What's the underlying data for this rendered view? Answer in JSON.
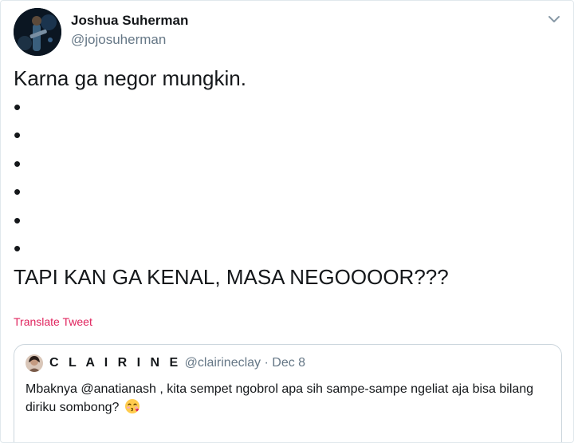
{
  "author": {
    "name": "Joshua Suherman",
    "handle": "@jojosuherman"
  },
  "tweet": {
    "text": "Karna ga negor mungkin.\n•\n•\n•\n•\n•\n•\nTAPI KAN GA KENAL, MASA NEGOOOOR???",
    "translate_label": "Translate Tweet"
  },
  "quoted_tweet": {
    "author_name": "C L A I R I N E",
    "author_handle": "@clairineclay",
    "separator": "·",
    "date": "Dec 8",
    "text": "Mbaknya @anatianash , kita sempet ngobrol apa sih sampe-sampe ngeliat aja bisa bilang diriku sombong?"
  },
  "icons": {
    "menu": "chevron-down-icon",
    "emoji": "kissing-face-emoji"
  },
  "colors": {
    "text": "#14171a",
    "secondary": "#657786",
    "translate": "#e0245e",
    "border": "#e1e8ed"
  }
}
